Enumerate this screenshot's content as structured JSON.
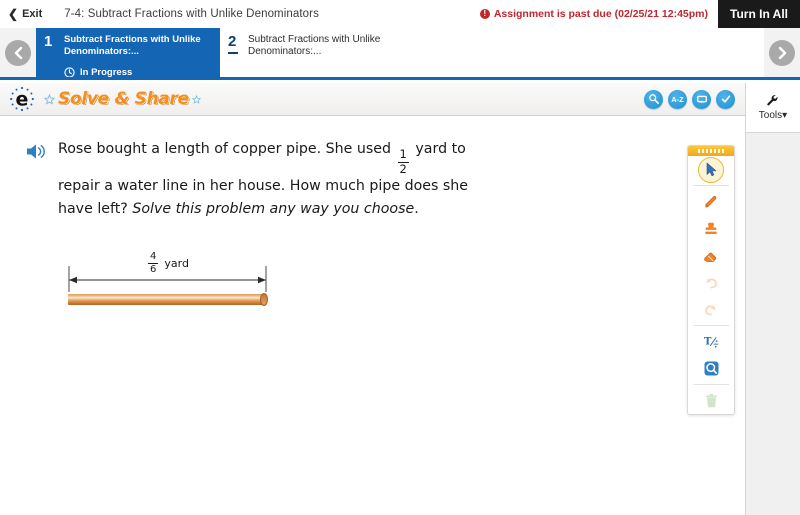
{
  "topbar": {
    "exit_label": "Exit",
    "lesson_title": "7-4: Subtract Fractions with Unlike Denominators",
    "alert_glyph": "!",
    "past_due_text": "Assignment is past due (02/25/21 12:45pm)",
    "turn_in_label": "Turn In All",
    "alert_color": "#c0262d",
    "turn_in_bg": "#1a1a1a"
  },
  "tabs": {
    "accent_color": "#1565b5",
    "prev_arrow": "‹",
    "next_arrow": "›",
    "items": [
      {
        "number": "1",
        "label": "Subtract Fractions with Unlike Denominators:...",
        "status": "In Progress",
        "active": true
      },
      {
        "number": "2",
        "label": "Subtract Fractions with Unlike Denominators:...",
        "status": "",
        "active": false
      }
    ]
  },
  "appheader": {
    "brand_letter": "e",
    "title": "Solve & Share",
    "title_color": "#f28f20",
    "icons": [
      {
        "name": "tool-search-icon",
        "label": ""
      },
      {
        "name": "glossary-az-icon",
        "label": "A-Z"
      },
      {
        "name": "whiteboard-icon",
        "label": ""
      },
      {
        "name": "check-icon",
        "label": ""
      }
    ]
  },
  "tools_button": {
    "label": "Tools",
    "caret": "▾"
  },
  "problem": {
    "speaker_icon": "audio-speaker-icon",
    "line1_a": "Rose bought a length of copper pipe. She used",
    "fraction1": {
      "numerator": "1",
      "denominator": "2"
    },
    "line2": "yard to repair a water line in her house. How much",
    "line3_a": "pipe does she have left?",
    "line3_italic": "Solve this problem any way",
    "line4_italic": "you choose",
    "line4_end": "."
  },
  "diagram": {
    "dimension_fraction": {
      "numerator": "4",
      "denominator": "6"
    },
    "dimension_unit": "yard",
    "pipe_color": "#d99c5e"
  },
  "palette": {
    "tools": [
      {
        "name": "select-arrow-tool",
        "selected": true,
        "disabled": false
      },
      {
        "name": "pencil-tool",
        "selected": false,
        "disabled": false
      },
      {
        "name": "stamp-tool",
        "selected": false,
        "disabled": false
      },
      {
        "name": "eraser-tool",
        "selected": false,
        "disabled": false
      },
      {
        "name": "undo-tool",
        "selected": false,
        "disabled": true
      },
      {
        "name": "redo-tool",
        "selected": false,
        "disabled": true
      },
      {
        "name": "math-text-tool",
        "selected": false,
        "disabled": false
      },
      {
        "name": "magnifier-tool",
        "selected": false,
        "disabled": false
      },
      {
        "name": "trash-tool",
        "selected": false,
        "disabled": true
      }
    ]
  }
}
